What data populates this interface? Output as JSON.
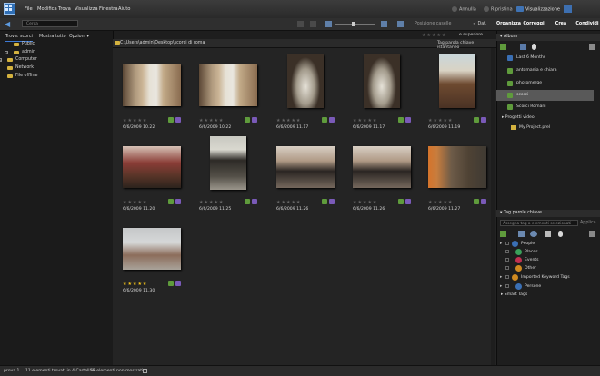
{
  "menubar": {
    "items": [
      "File",
      "Modifica",
      "Trova",
      "Visualizza",
      "Finestra",
      "Aiuto"
    ],
    "undo_label": "Annulla",
    "redo_label": "Ripristina",
    "view_label": "Visualizzazione"
  },
  "toolbar": {
    "search_placeholder": "Cerca",
    "position_label": "Posizione caselle",
    "date_toggle_label": "Dat."
  },
  "mode_tabs": [
    {
      "label": "Organizza",
      "color": "#2e6fc8"
    },
    {
      "label": "Correggi",
      "color": "#d07f1e"
    },
    {
      "label": "Crea",
      "color": "#b02f40"
    },
    {
      "label": "Condividi",
      "color": "#4f8f2f"
    }
  ],
  "left_panel": {
    "tab_search": "Trova: scorci",
    "tab_show_all": "Mostra tutto",
    "tab_options": "Opzioni",
    "tree": [
      {
        "label": "Public",
        "level": 1,
        "expander": ""
      },
      {
        "label": "admin",
        "level": 1,
        "expander": "+"
      },
      {
        "label": "Computer",
        "level": 0,
        "expander": "+"
      },
      {
        "label": "Network",
        "level": 0,
        "expander": ""
      },
      {
        "label": "File offline",
        "level": 0,
        "expander": ""
      }
    ]
  },
  "main": {
    "rating_filter_label": "e superiore",
    "path": "C:\\Users\\admin\\Desktop\\scorci di roma",
    "tag_toggle_label": "Tag parola chiave istantaneo",
    "photos": [
      {
        "date": "6/6/2009 10.22",
        "rating": 0,
        "scene": "street"
      },
      {
        "date": "6/6/2009 10.22",
        "rating": 0,
        "scene": "street"
      },
      {
        "date": "6/6/2009 11.17",
        "rating": 0,
        "scene": "arch"
      },
      {
        "date": "6/6/2009 11.17",
        "rating": 0,
        "scene": "arch"
      },
      {
        "date": "6/6/2009 11.19",
        "rating": 0,
        "scene": "horse"
      },
      {
        "date": "6/6/2009 11.20",
        "rating": 0,
        "scene": "horse2"
      },
      {
        "date": "6/6/2009 11.25",
        "rating": 0,
        "scene": "carriage"
      },
      {
        "date": "6/6/2009 11.26",
        "rating": 0,
        "scene": "carriages"
      },
      {
        "date": "6/6/2009 11.26",
        "rating": 0,
        "scene": "carriages"
      },
      {
        "date": "6/6/2009 11.27",
        "rating": 0,
        "scene": "horse3"
      },
      {
        "date": "6/6/2009 11.30",
        "rating": 5,
        "scene": "feet"
      }
    ]
  },
  "albums": {
    "header": "Album",
    "items": [
      {
        "label": "Last 6 Months",
        "color": "#3a6fb4",
        "selected": false
      },
      {
        "label": "antomania e chiara",
        "color": "#5f9b3c",
        "selected": false
      },
      {
        "label": "photomerge",
        "color": "#5f9b3c",
        "selected": false
      },
      {
        "label": "scorci",
        "color": "#5f9b3c",
        "selected": true
      },
      {
        "label": "Scorci Romani",
        "color": "#5f9b3c",
        "selected": false
      }
    ],
    "projects_label": "Progetti video",
    "project_item": "My Project.prel"
  },
  "tags": {
    "header": "Tag parole chiave",
    "input_placeholder": "Assegna tag a elementi selezionati",
    "apply_label": "Applica",
    "items": [
      {
        "label": "People",
        "color": "#3a6fb4",
        "expanded": true
      },
      {
        "label": "Places",
        "color": "#3aa05a",
        "expanded": false
      },
      {
        "label": "Events",
        "color": "#c03050",
        "expanded": false
      },
      {
        "label": "Other",
        "color": "#d08a20",
        "expanded": false
      },
      {
        "label": "Imported Keyword Tags",
        "color": "#d08a20",
        "expanded": true
      },
      {
        "label": "Persone",
        "color": "#3a6fb4",
        "expanded": true
      }
    ],
    "smart_tags_label": "Smart Tags"
  },
  "statusbar": {
    "left": "prova 1",
    "count": "11 elementi trovati in 4 Cartellale",
    "hidden": "59 elementi non mostrati"
  }
}
